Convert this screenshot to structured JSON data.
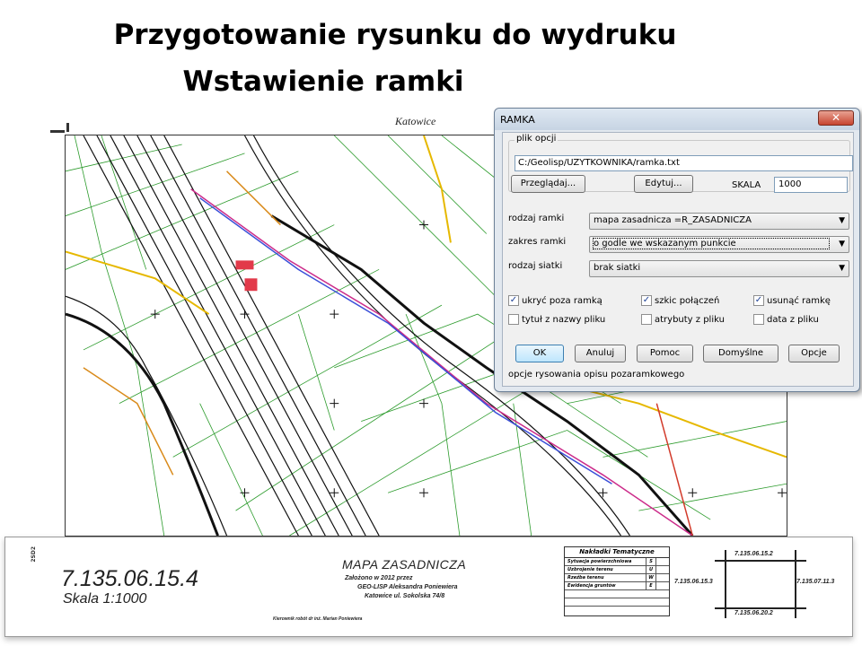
{
  "slide": {
    "title_line1": "Przygotowanie rysunku do wydruku",
    "title_line2": "Wstawienie ramki"
  },
  "map": {
    "top_label": "Katowice"
  },
  "dialog": {
    "title": "RAMKA",
    "close_glyph": "✕",
    "options_group_label": "plik opcji",
    "options_path": "C:/Geolisp/UZYTKOWNIKA/ramka.txt",
    "browse_button": "Przeglądaj...",
    "edit_button": "Edytuj...",
    "scale_label": "SKALA",
    "scale_value": "1000",
    "frame_type_label": "rodzaj ramki",
    "frame_type_value": "mapa zasadnicza =R_ZASADNICZA",
    "frame_range_label": "zakres ramki",
    "frame_range_value": "o godle we wskazanym punkcie",
    "grid_type_label": "rodzaj siatki",
    "grid_type_value": "brak siatki",
    "checkboxes": [
      {
        "label": "ukryć poza ramką",
        "checked": true
      },
      {
        "label": "szkic połączeń",
        "checked": true
      },
      {
        "label": "usunąć ramkę",
        "checked": true
      },
      {
        "label": "tytuł z nazwy pliku",
        "checked": false
      },
      {
        "label": "atrybuty z pliku",
        "checked": false
      },
      {
        "label": "data z pliku",
        "checked": false
      }
    ],
    "buttons": {
      "ok": "OK",
      "cancel": "Anuluj",
      "help": "Pomoc",
      "defaults": "Domyślne",
      "options": "Opcje"
    },
    "footer_text": "opcje rysowania opisu pozaramkowego"
  },
  "frame_strip": {
    "sheet_number": "7.135.06.15.4",
    "scale_text": "Skala  1:1000",
    "vertical_code": "2SD2",
    "map_title": "MAPA ZASADNICZA",
    "founded_line": "Założono w        2012    przez",
    "company_line": "GEO-LISP Aleksandra Poniewiera",
    "address_line": "Katowice  ul. Sokolska 74/8",
    "works_manager": "Kierownik robót        dr inż. Marian Poniewiera",
    "legend_title": "Nakładki Tematyczne",
    "legend_rows": [
      {
        "label": "Sytuacja powierzchniowa",
        "code": "S"
      },
      {
        "label": "Uzbrojenie terenu",
        "code": "U"
      },
      {
        "label": "Rzeźba terenu",
        "code": "W"
      },
      {
        "label": "Ewidencja gruntów",
        "code": "E"
      }
    ],
    "neighbors": {
      "north": "7.135.06.15.2",
      "west": "7.135.06.15.3",
      "east": "7.135.07.11.3",
      "south": "7.135.06.20.2"
    }
  }
}
